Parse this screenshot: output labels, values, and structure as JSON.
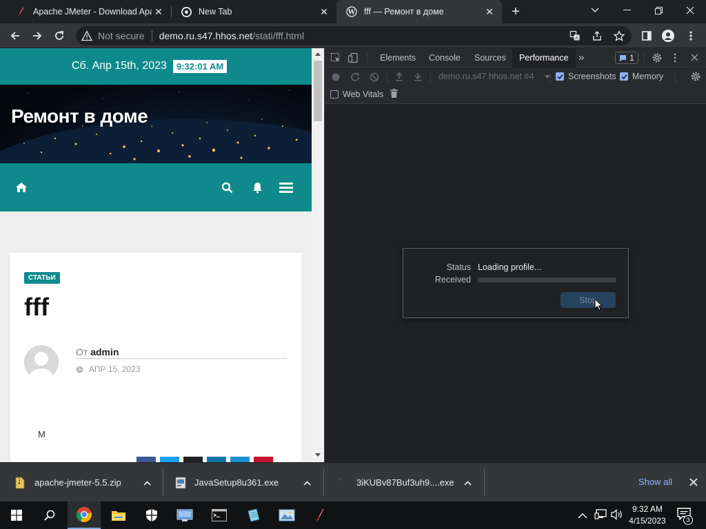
{
  "browser": {
    "tabs": [
      {
        "title": "Apache JMeter - Download Apac",
        "icon": "jmeter-feather-icon",
        "active": false
      },
      {
        "title": "New Tab",
        "icon": "chrome-icon",
        "active": false
      },
      {
        "title": "fff — Ремонт в доме",
        "icon": "wordpress-icon",
        "active": true
      }
    ],
    "new_tab": "+",
    "omnibox": {
      "security": "Not secure",
      "host": "demo.ru.s47.hhos.net",
      "path": "/stati/fff.html"
    }
  },
  "page": {
    "date": "Сб. Апр 15th, 2023",
    "clock": "9:32:01 AM",
    "site_title": "Ремонт в доме",
    "category": "СТАТЬИ",
    "post_title": "fff",
    "by_prefix": "От",
    "author": "admin",
    "post_date": "АПР 15, 2023",
    "excerpt": "M"
  },
  "devtools": {
    "tabs": [
      "Elements",
      "Console",
      "Sources",
      "Performance"
    ],
    "active_tab": "Performance",
    "more": "»",
    "issues_count": "1",
    "target": "demo.ru.s47.hhos.net #4",
    "screenshots_label": "Screenshots",
    "memory_label": "Memory",
    "web_vitals_label": "Web Vitals",
    "dialog": {
      "status_label": "Status",
      "status_value": "Loading profile...",
      "received_label": "Received",
      "progress": 0,
      "stop_label": "Stop"
    }
  },
  "downloads": {
    "items": [
      {
        "name": "apache-jmeter-5.5.zip"
      },
      {
        "name": "JavaSetup8u361.exe"
      },
      {
        "name": "3iKUBv87Buf3uh9....exe"
      }
    ],
    "show_all": "Show all"
  },
  "taskbar": {
    "time": "9:32 AM",
    "date": "4/15/2023",
    "notifications": "3"
  },
  "colors": {
    "brand_teal": "#0e8a8d",
    "devtools_accent": "#8ab4f8"
  }
}
